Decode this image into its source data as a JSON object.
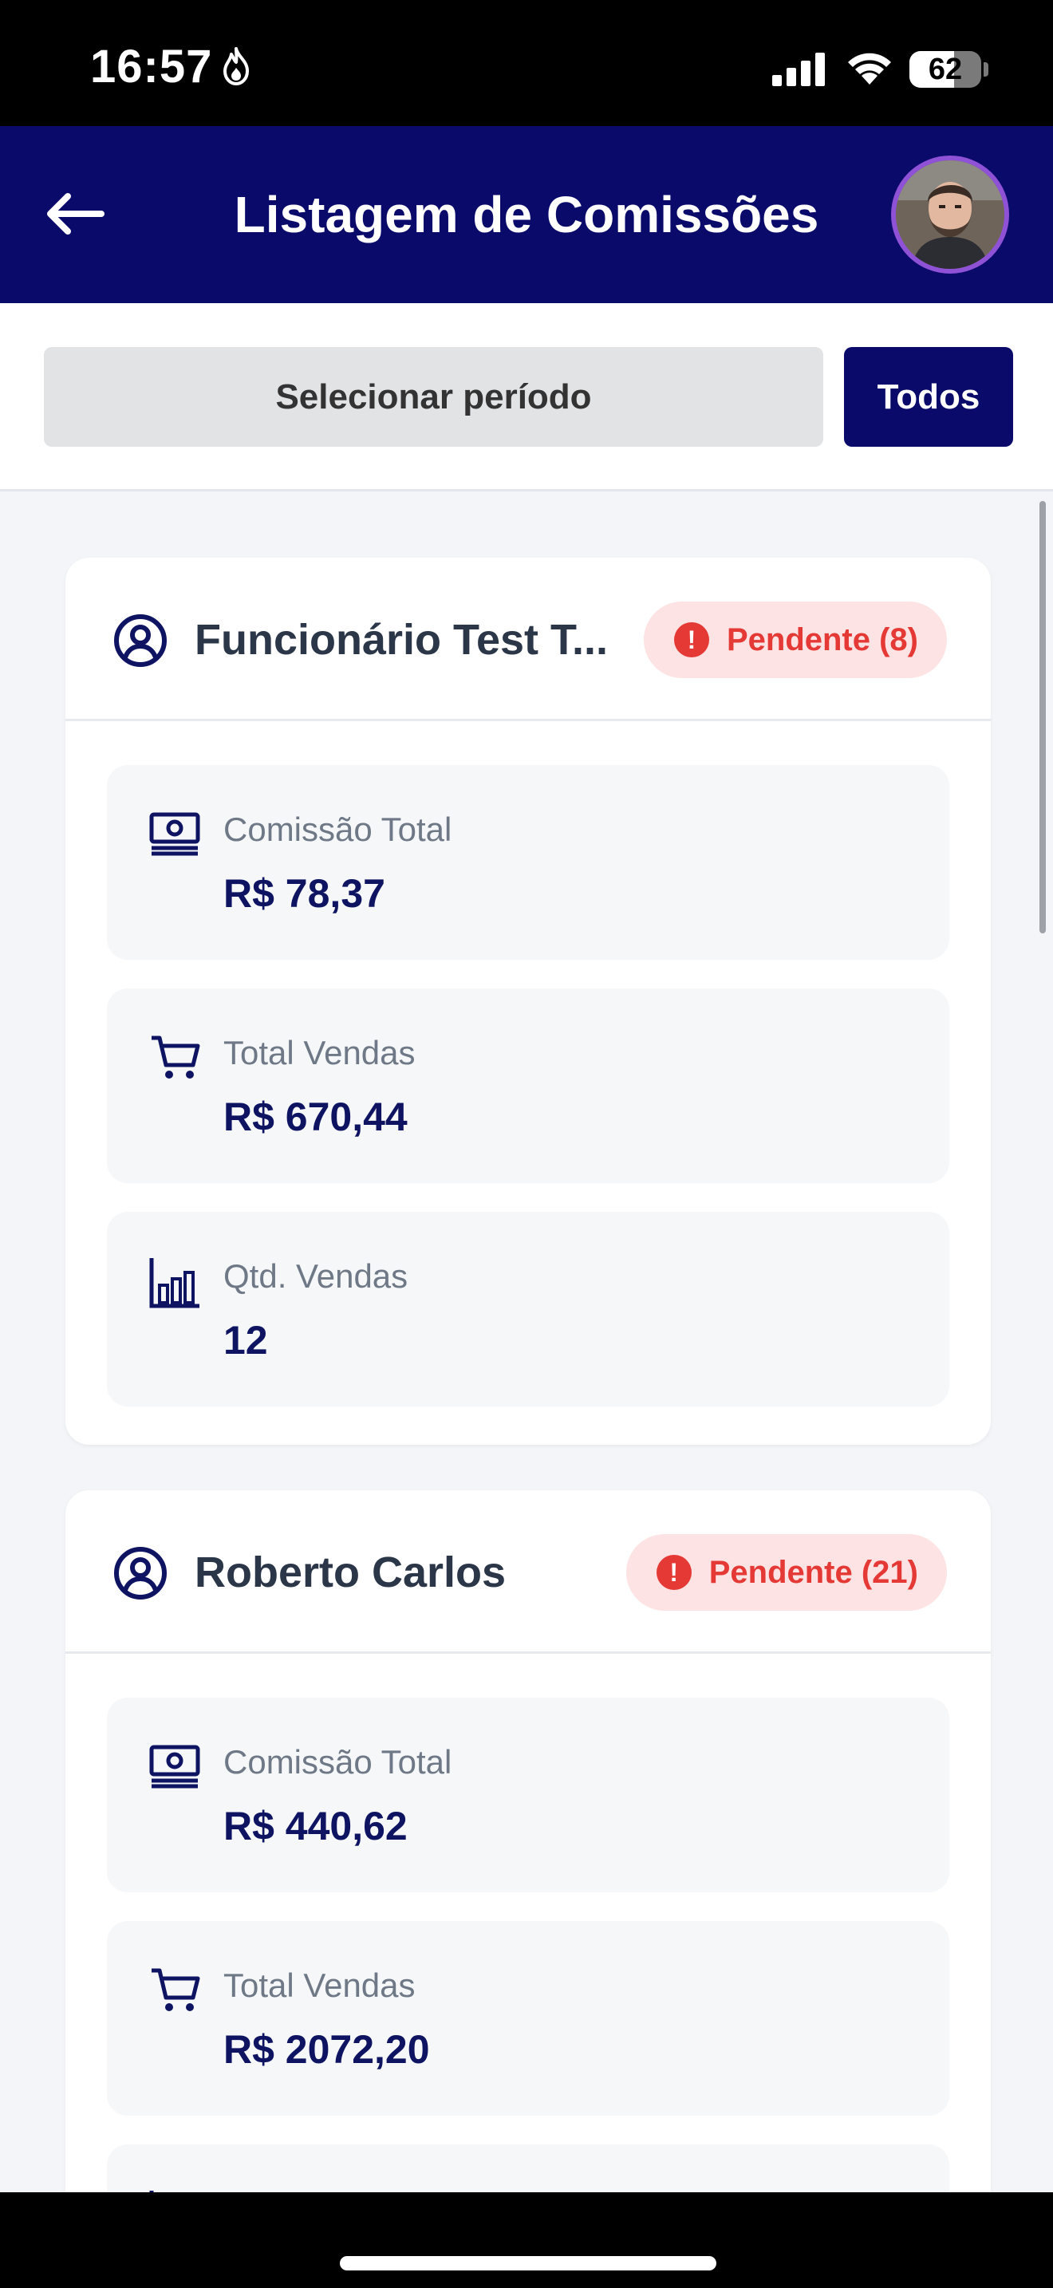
{
  "status_bar": {
    "time": "16:57",
    "battery_level": "62",
    "battery_fraction": 0.62,
    "icons": [
      "flame-icon",
      "signal-icon",
      "wifi-icon",
      "battery-icon"
    ]
  },
  "header": {
    "title": "Listagem de Comissões",
    "back_icon": "arrow-left-icon",
    "background_color": "#0a0a6b"
  },
  "filters": {
    "period_label": "Selecionar período",
    "todos_label": "Todos"
  },
  "cards": [
    {
      "name": "Funcionário Test T...",
      "status": "Pendente (8)",
      "stats": [
        {
          "icon": "money-icon",
          "label": "Comissão Total",
          "value": "R$ 78,37"
        },
        {
          "icon": "cart-icon",
          "label": "Total Vendas",
          "value": "R$ 670,44"
        },
        {
          "icon": "bar-chart-icon",
          "label": "Qtd. Vendas",
          "value": "12"
        }
      ]
    },
    {
      "name": "Roberto Carlos",
      "status": "Pendente (21)",
      "stats": [
        {
          "icon": "money-icon",
          "label": "Comissão Total",
          "value": "R$ 440,62"
        },
        {
          "icon": "cart-icon",
          "label": "Total Vendas",
          "value": "R$ 2072,20"
        },
        {
          "icon": "bar-chart-icon",
          "label": "",
          "value": ""
        }
      ]
    }
  ],
  "colors": {
    "navy": "#0a0a6b",
    "pending_red": "#e53935",
    "pending_bg": "#fde3e3",
    "value_text": "#0e1462"
  }
}
